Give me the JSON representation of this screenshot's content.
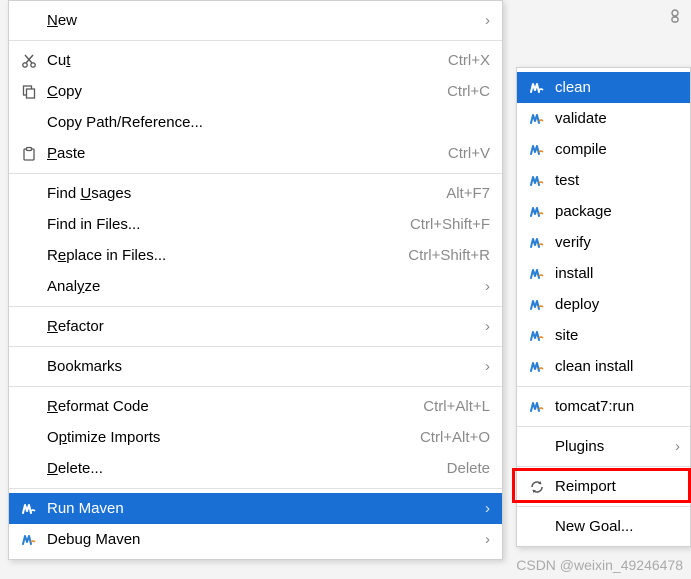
{
  "main_menu": [
    {
      "id": "new",
      "label": "New",
      "icon": null,
      "shortcut": "",
      "submenu": true,
      "underline": 0
    },
    "---",
    {
      "id": "cut",
      "label": "Cut",
      "icon": "cut-icon",
      "shortcut": "Ctrl+X",
      "underline": 2
    },
    {
      "id": "copy",
      "label": "Copy",
      "icon": "copy-icon",
      "shortcut": "Ctrl+C",
      "underline": 0
    },
    {
      "id": "copypath",
      "label": "Copy Path/Reference...",
      "icon": null,
      "shortcut": ""
    },
    {
      "id": "paste",
      "label": "Paste",
      "icon": "paste-icon",
      "shortcut": "Ctrl+V",
      "underline": 0
    },
    "---",
    {
      "id": "findusages",
      "label": "Find Usages",
      "icon": null,
      "shortcut": "Alt+F7",
      "underline": 5
    },
    {
      "id": "findinfiles",
      "label": "Find in Files...",
      "icon": null,
      "shortcut": "Ctrl+Shift+F"
    },
    {
      "id": "replaceinfiles",
      "label": "Replace in Files...",
      "icon": null,
      "shortcut": "Ctrl+Shift+R",
      "underline": 1
    },
    {
      "id": "analyze",
      "label": "Analyze",
      "icon": null,
      "shortcut": "",
      "submenu": true,
      "underline": 4
    },
    "---",
    {
      "id": "refactor",
      "label": "Refactor",
      "icon": null,
      "shortcut": "",
      "submenu": true,
      "underline": 0
    },
    "---",
    {
      "id": "bookmarks",
      "label": "Bookmarks",
      "icon": null,
      "shortcut": "",
      "submenu": true
    },
    "---",
    {
      "id": "reformat",
      "label": "Reformat Code",
      "icon": null,
      "shortcut": "Ctrl+Alt+L",
      "underline": 0
    },
    {
      "id": "optimize",
      "label": "Optimize Imports",
      "icon": null,
      "shortcut": "Ctrl+Alt+O",
      "underline": 1
    },
    {
      "id": "delete",
      "label": "Delete...",
      "icon": null,
      "shortcut": "Delete",
      "underline": 0
    },
    "---",
    {
      "id": "runmaven",
      "label": "Run Maven",
      "icon": "maven-icon",
      "shortcut": "",
      "submenu": true,
      "selected": true
    },
    {
      "id": "debugmaven",
      "label": "Debug Maven",
      "icon": "maven-icon",
      "shortcut": "",
      "submenu": true
    }
  ],
  "sub_menu": [
    {
      "id": "clean",
      "label": "clean",
      "icon": "maven-icon",
      "selected": true
    },
    {
      "id": "validate",
      "label": "validate",
      "icon": "maven-icon"
    },
    {
      "id": "compile",
      "label": "compile",
      "icon": "maven-icon"
    },
    {
      "id": "test",
      "label": "test",
      "icon": "maven-icon"
    },
    {
      "id": "package",
      "label": "package",
      "icon": "maven-icon"
    },
    {
      "id": "verify",
      "label": "verify",
      "icon": "maven-icon"
    },
    {
      "id": "install",
      "label": "install",
      "icon": "maven-icon"
    },
    {
      "id": "deploy",
      "label": "deploy",
      "icon": "maven-icon"
    },
    {
      "id": "site",
      "label": "site",
      "icon": "maven-icon"
    },
    {
      "id": "cleaninstall",
      "label": "clean install",
      "icon": "maven-icon"
    },
    "---",
    {
      "id": "tomcat7run",
      "label": "tomcat7:run",
      "icon": "maven-icon"
    },
    "---",
    {
      "id": "plugins",
      "label": "Plugins",
      "icon": null,
      "submenu": true
    },
    "---",
    {
      "id": "reimport",
      "label": "Reimport",
      "icon": "refresh-icon",
      "highlighted": true
    },
    "---",
    {
      "id": "newgoal",
      "label": "New Goal...",
      "icon": null
    }
  ],
  "watermark": "CSDN @weixin_49246478"
}
